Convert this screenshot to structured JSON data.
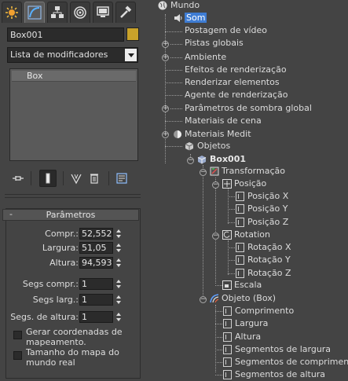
{
  "object_name": "Box001",
  "modifier_list": "Lista de modificadores",
  "stack_item": "Box",
  "rollout_title": "Parâmetros",
  "rollout_toggle": "-",
  "params": [
    {
      "label": "Compr.:",
      "value": "52,552"
    },
    {
      "label": "Largura:",
      "value": "51,05"
    },
    {
      "label": "Altura:",
      "value": "94,593"
    }
  ],
  "segs": [
    {
      "label": "Segs compr.:",
      "value": "1"
    },
    {
      "label": "Segs larg.:",
      "value": "1"
    },
    {
      "label": "Segs. de altura:",
      "value": "1"
    }
  ],
  "checks": [
    {
      "label_line1": "Gerar coordenadas de",
      "label_line2": "mapeamento."
    },
    {
      "label_line1": "Tamanho do mapa do",
      "label_line2": "mundo real"
    }
  ],
  "tree": {
    "root": "Mundo",
    "som": "Som",
    "postagem": "Postagem de vídeo",
    "pistas": "Pistas globais",
    "ambiente": "Ambiente",
    "efeitos": "Efeitos de renderização",
    "renderizar": "Renderizar elementos",
    "agente": "Agente de renderização",
    "sombra": "Parâmetros de sombra global",
    "materiais_cena": "Materiais de cena",
    "materiais_medit": "Materiais Medit",
    "objetos": "Objetos",
    "box": "Box001",
    "transformacao": "Transformação",
    "posicao": "Posição",
    "posx": "Posição X",
    "posy": "Posição Y",
    "posz": "Posição Z",
    "rotation": "Rotation",
    "rotx": "Rotação X",
    "roty": "Rotação Y",
    "rotz": "Rotação Z",
    "escala": "Escala",
    "objeto_box": "Objeto (Box)",
    "comprimento": "Comprimento",
    "largura": "Largura",
    "altura": "Altura",
    "seg_largura": "Segmentos de largura",
    "seg_comprimento": "Segmentos de comprimento",
    "seg_altura": "Segmentos de altura"
  },
  "colors": {
    "swatch": "#c9a22a",
    "selection": "#3e7cd3",
    "panel": "#444444"
  }
}
